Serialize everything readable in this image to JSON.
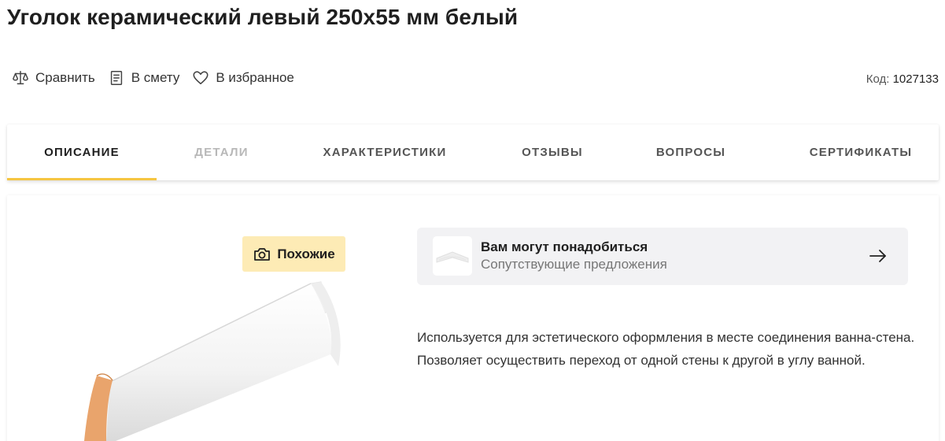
{
  "product": {
    "title": "Уголок керамический левый 250х55 мм белый",
    "code_label": "Код:",
    "code_value": "1027133"
  },
  "actions": [
    {
      "label": "Сравнить",
      "icon": "scales-icon"
    },
    {
      "label": "В смету",
      "icon": "document-icon"
    },
    {
      "label": "В избранное",
      "icon": "heart-icon"
    }
  ],
  "tabs": [
    {
      "label": "ОПИСАНИЕ",
      "state": "active"
    },
    {
      "label": "ДЕТАЛИ",
      "state": "disabled"
    },
    {
      "label": "ХАРАКТЕРИСТИКИ",
      "state": "normal"
    },
    {
      "label": "ОТЗЫВЫ",
      "state": "normal"
    },
    {
      "label": "ВОПРОСЫ",
      "state": "normal"
    },
    {
      "label": "СЕРТИФИКАТЫ",
      "state": "normal"
    }
  ],
  "similar_button": {
    "label": "Похожие",
    "icon": "camera-icon"
  },
  "suggestion": {
    "title": "Вам могут понадобиться",
    "subtitle": "Сопутствующие предложения",
    "icon": "arrow-right-icon"
  },
  "description": "Используется для эстетического оформления в месте соединения ванна-стена. Позволяет осуществить переход от одной стены к другой в углу ванной.",
  "colors": {
    "accent": "#f5c542",
    "similar_bg": "#fdebb5",
    "suggest_bg": "#f2f2f4",
    "disabled_tab": "#b8b8b8"
  }
}
